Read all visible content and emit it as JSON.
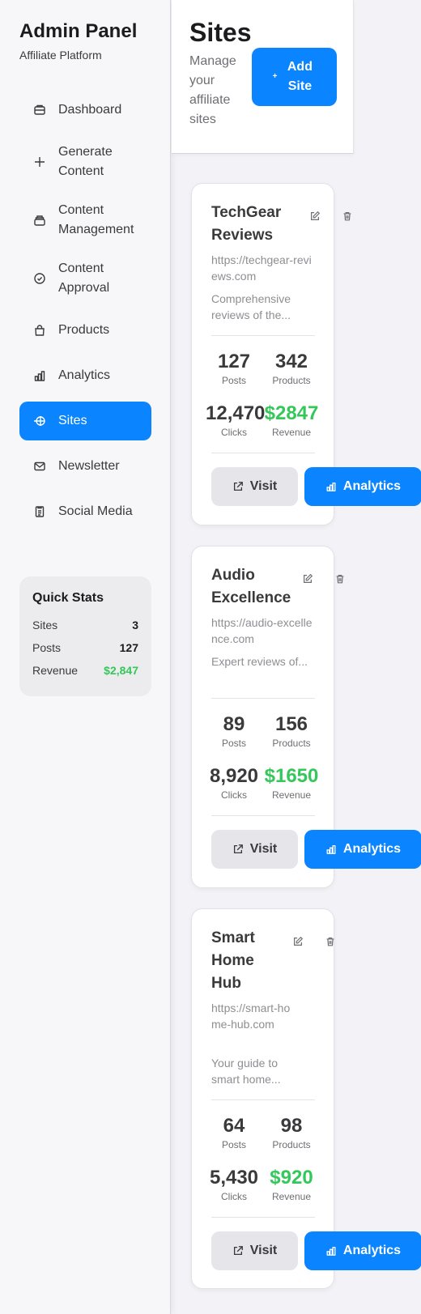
{
  "brand": {
    "title": "Admin Panel",
    "subtitle": "Affiliate Platform"
  },
  "nav": [
    {
      "label": "Dashboard",
      "icon": "dashboard-icon"
    },
    {
      "label": "Generate Content",
      "icon": "plus-icon"
    },
    {
      "label": "Content Management",
      "icon": "content-icon"
    },
    {
      "label": "Content Approval",
      "icon": "check-circle-icon"
    },
    {
      "label": "Products",
      "icon": "bag-icon"
    },
    {
      "label": "Analytics",
      "icon": "chart-icon"
    },
    {
      "label": "Sites",
      "icon": "sites-icon",
      "active": true
    },
    {
      "label": "Newsletter",
      "icon": "mail-icon"
    },
    {
      "label": "Social Media",
      "icon": "doc-icon"
    }
  ],
  "quick_stats": {
    "title": "Quick Stats",
    "rows": [
      {
        "label": "Sites",
        "value": "3"
      },
      {
        "label": "Posts",
        "value": "127"
      },
      {
        "label": "Revenue",
        "value": "$2,847"
      }
    ]
  },
  "header": {
    "title": "Sites",
    "subtitle": "Manage your affiliate sites",
    "add_label": "Add Site",
    "add_icon": "+"
  },
  "labels": {
    "posts": "Posts",
    "products": "Products",
    "clicks": "Clicks",
    "revenue": "Revenue",
    "visit": "Visit",
    "analytics": "Analytics"
  },
  "sites": [
    {
      "name": "TechGear Reviews",
      "url": "https://techgear-reviews.com",
      "description": "Comprehensive reviews of the...",
      "posts": "127",
      "products": "342",
      "clicks": "12,470",
      "revenue": "$2847"
    },
    {
      "name": "Audio Excellence",
      "url": "https://audio-excellence.com",
      "description": "Expert reviews of...",
      "posts": "89",
      "products": "156",
      "clicks": "8,920",
      "revenue": "$1650"
    },
    {
      "name": "Smart Home Hub",
      "url": "https://smart-home-hub.com",
      "description": "Your guide to smart home...",
      "posts": "64",
      "products": "98",
      "clicks": "5,430",
      "revenue": "$920"
    }
  ],
  "colors": {
    "accent": "#0a84ff",
    "success": "#34c759"
  }
}
